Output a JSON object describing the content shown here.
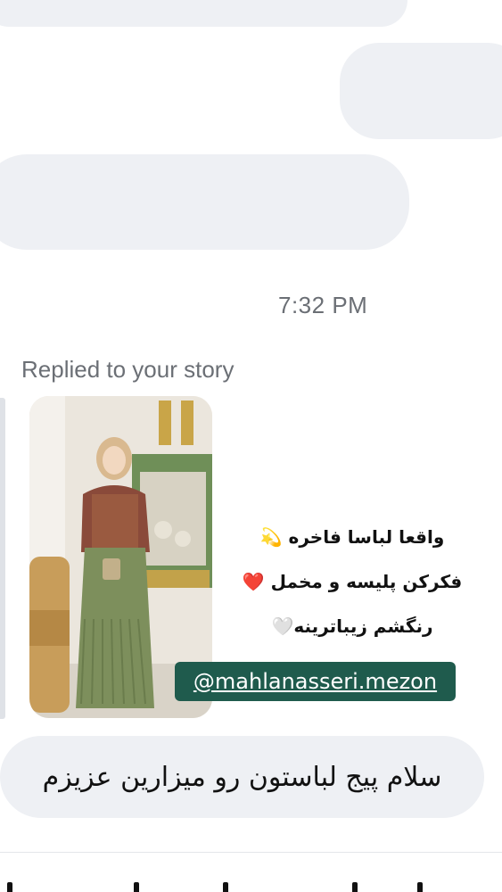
{
  "thread": {
    "timestamp": "7:32 PM",
    "story_reply": {
      "caption": "Replied to your story",
      "story_lines": [
        "واقعا لباسا فاخره 💫",
        "فکرکن پلیسه و مخمل ❤️",
        "رنگشم زیباترینه🤍"
      ],
      "mention": "@mahlanasseri.mezon"
    },
    "message": "سلام پیج لباستون رو میزارین عزیزم"
  },
  "colors": {
    "bubble": "#eef0f4",
    "meta_text": "#6b6f75",
    "mention_bg": "#1f5b4d"
  }
}
